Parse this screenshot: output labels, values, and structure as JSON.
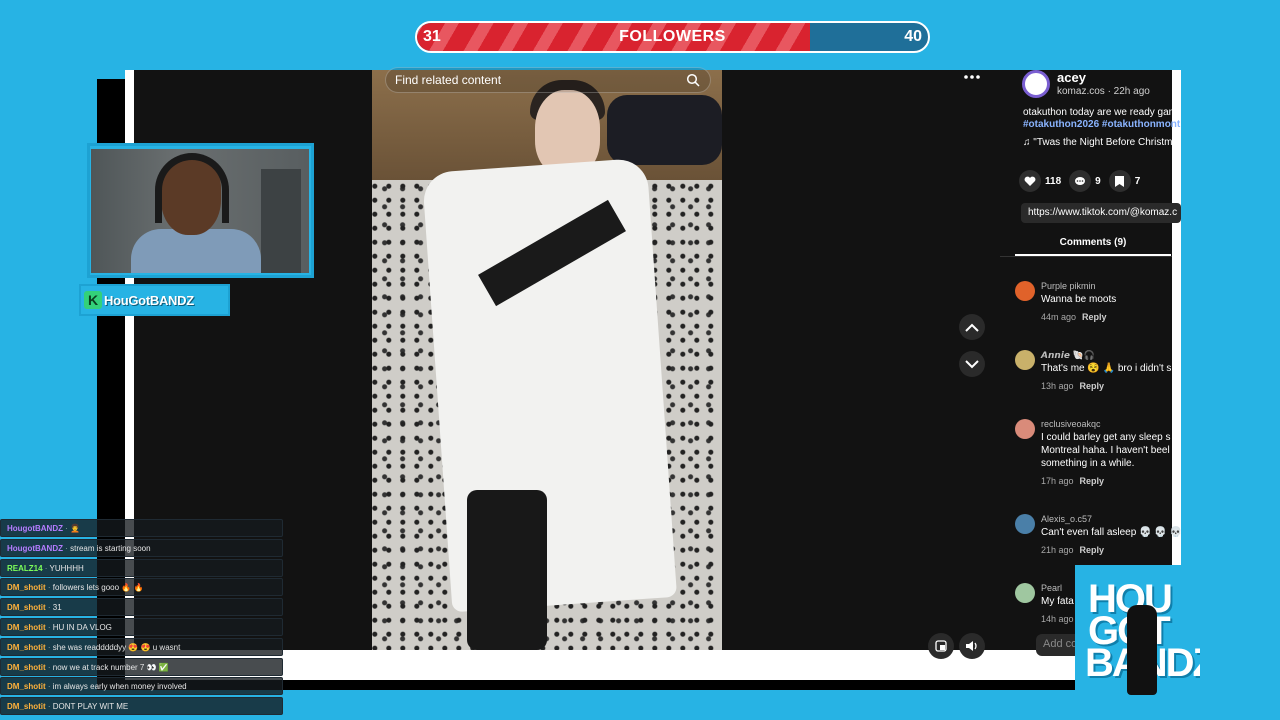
{
  "goal": {
    "label": "FOLLOWERS",
    "current": "31",
    "target": "40",
    "progress_fraction": 0.77,
    "fill_color": "#d9232f"
  },
  "video": {
    "search_placeholder": "Find related content"
  },
  "post": {
    "author": "acey",
    "meta": "komaz.cos · 22h ago",
    "caption": "otakuthon today are we ready gang",
    "hashtags": "#otakuthon2026 #otakuthonmont",
    "music": "\"Twas the Night Before Christm",
    "likes": "118",
    "comments_count": "9",
    "saves": "7",
    "link": "https://www.tiktok.com/@komaz.c",
    "comments_tab": "Comments (9)",
    "add_comment_placeholder": "Add co"
  },
  "comments": [
    {
      "user": "Purple pikmin",
      "text": "Wanna be moots",
      "time": "44m ago",
      "reply": "Reply",
      "avatar_color": "#e0622a"
    },
    {
      "user": "𝘼𝙣𝙣𝙞𝙚 🐚🎧",
      "text": "That's me 😵 🙏 bro i didn't s",
      "time": "13h ago",
      "reply": "Reply",
      "avatar_color": "#c9b16a"
    },
    {
      "user": "reclusiveoakqc",
      "text": "I could barley get any sleep s",
      "text2": "Montreal haha. I haven't beel",
      "text3": "something in a while.",
      "time": "17h ago",
      "reply": "Reply",
      "avatar_color": "#d98b7a"
    },
    {
      "user": "Alexis_o.c57",
      "text": "Can't even fall asleep 💀 💀 💀",
      "time": "21h ago",
      "reply": "Reply",
      "avatar_color": "#4a7fa8"
    },
    {
      "user": "Pearl",
      "text": "My fata",
      "time": "14h ago",
      "reply": "Reply",
      "avatar_color": "#9fc7a0"
    }
  ],
  "streamer": {
    "name": "HouGotBANDZ",
    "badge": "K"
  },
  "chat": [
    {
      "user": "HougotBANDZ",
      "msg": "🧑‍🦱",
      "color": "#b57cff"
    },
    {
      "user": "HougotBANDZ",
      "msg": "stream is starting soon",
      "color": "#b57cff"
    },
    {
      "user": "REALZ14",
      "msg": "YUHHHH",
      "color": "#7dff5a"
    },
    {
      "user": "DM_shotit",
      "msg": "followers lets gooo 🔥 🔥",
      "color": "#ffb13b"
    },
    {
      "user": "DM_shotit",
      "msg": "31",
      "color": "#ffb13b"
    },
    {
      "user": "DM_shotit",
      "msg": "HU IN DA VLOG",
      "color": "#ffb13b"
    },
    {
      "user": "DM_shotit",
      "msg": "she was readddddyy 😍 😍 u wasnt",
      "color": "#ffb13b"
    },
    {
      "user": "DM_shotit",
      "msg": "now we at track number 7 👀 ✅",
      "color": "#ffb13b"
    },
    {
      "user": "DM_shotit",
      "msg": "im always early when money involved",
      "color": "#ffb13b"
    },
    {
      "user": "DM_shotit",
      "msg": "DONT PLAY WIT ME",
      "color": "#ffb13b"
    }
  ],
  "logo": {
    "line1": "HOU",
    "line2": "GOT",
    "line3": "BANDZ"
  }
}
